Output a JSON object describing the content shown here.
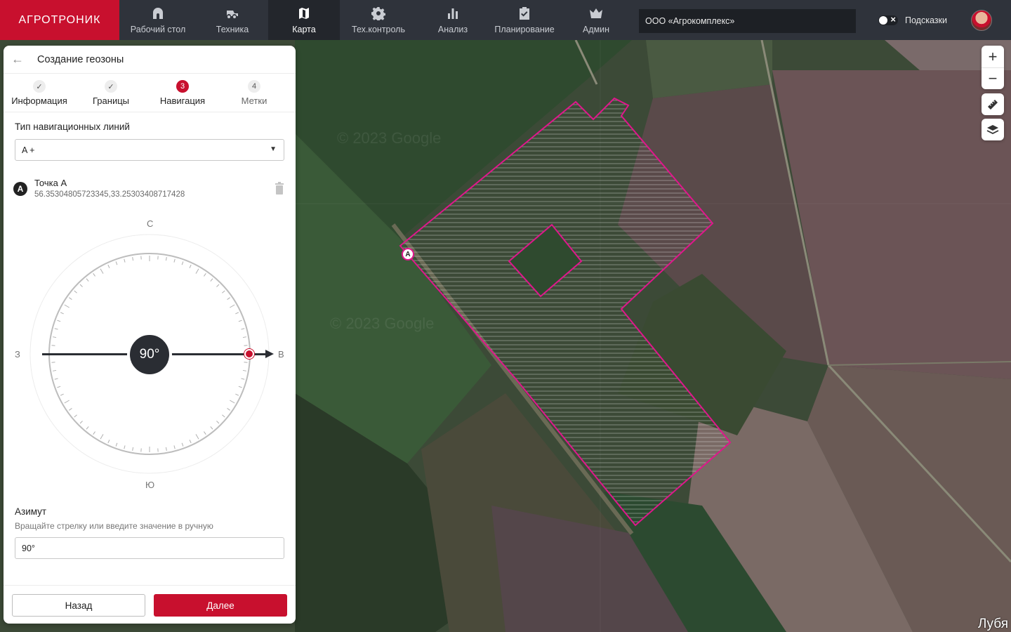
{
  "app": {
    "logo": "АГРОТРОНИК",
    "nav": [
      {
        "label": "Рабочий стол",
        "icon": "home-icon"
      },
      {
        "label": "Техника",
        "icon": "tractor-icon"
      },
      {
        "label": "Карта",
        "icon": "map-icon",
        "active": true
      },
      {
        "label": "Тех.контроль",
        "icon": "gear-icon"
      },
      {
        "label": "Анализ",
        "icon": "bar-chart-icon"
      },
      {
        "label": "Планирование",
        "icon": "clipboard-check-icon"
      },
      {
        "label": "Админ",
        "icon": "crown-icon"
      }
    ],
    "organization": "ООО «Агрокомплекс»",
    "hints_label": "Подсказки",
    "hints_enabled": false,
    "accent_color": "#c8102e"
  },
  "panel": {
    "title": "Создание геозоны",
    "steps": [
      {
        "marker": "✓",
        "label": "Информация",
        "state": "done"
      },
      {
        "marker": "✓",
        "label": "Границы",
        "state": "done"
      },
      {
        "marker": "3",
        "label": "Навигация",
        "state": "current"
      },
      {
        "marker": "4",
        "label": "Метки",
        "state": "pending"
      }
    ],
    "nav_line_type_label": "Тип навигационных линий",
    "nav_line_type_value": "A +",
    "point": {
      "badge": "A",
      "name": "Точка А",
      "coords": "56.35304805723345,33.25303408717428"
    },
    "compass": {
      "north": "С",
      "south": "Ю",
      "west": "З",
      "east": "В",
      "angle_display": "90°",
      "azimuth_deg": 90
    },
    "azimuth_label": "Азимут",
    "azimuth_hint": "Вращайте стрелку или введите значение в ручную",
    "azimuth_value": "90°",
    "back_label": "Назад",
    "next_label": "Далее"
  },
  "map": {
    "point_marker": "A",
    "watermark": "© 2023 Google",
    "place_label": "Лубя",
    "geofence_color": "#e0168c"
  }
}
